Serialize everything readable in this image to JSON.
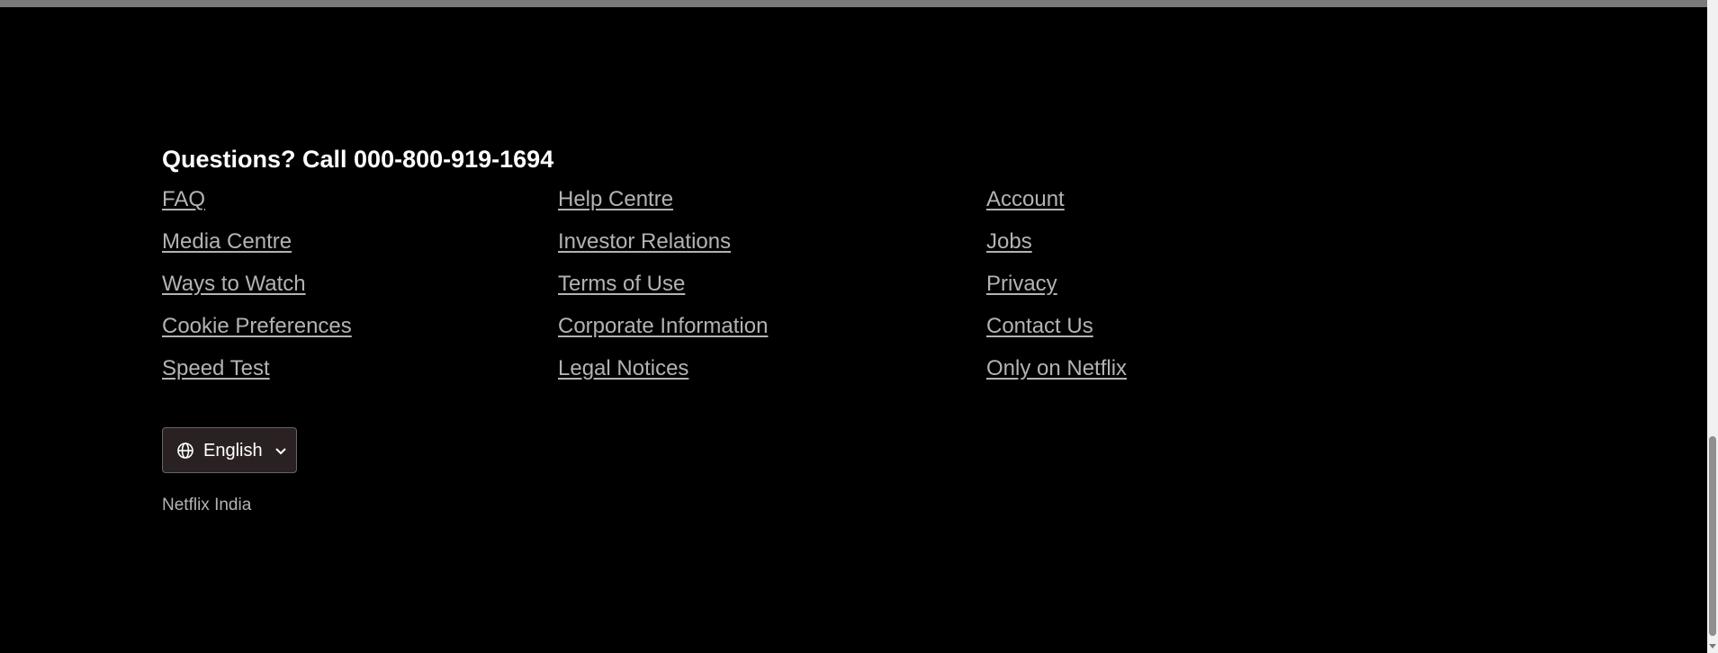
{
  "footer": {
    "heading": "Questions? Call 000-800-919-1694",
    "links": [
      {
        "label": "FAQ"
      },
      {
        "label": "Help Centre"
      },
      {
        "label": "Account"
      },
      {
        "label": "Media Centre"
      },
      {
        "label": "Investor Relations"
      },
      {
        "label": "Jobs"
      },
      {
        "label": "Ways to Watch"
      },
      {
        "label": "Terms of Use"
      },
      {
        "label": "Privacy"
      },
      {
        "label": "Cookie Preferences"
      },
      {
        "label": "Corporate Information"
      },
      {
        "label": "Contact Us"
      },
      {
        "label": "Speed Test"
      },
      {
        "label": "Legal Notices"
      },
      {
        "label": "Only on Netflix"
      }
    ],
    "language_selector": {
      "label": "English",
      "icon": "globe-icon",
      "dropdown_icon": "chevron-down-icon"
    },
    "region": "Netflix India"
  },
  "colors": {
    "background": "#000000",
    "heading": "#ffffff",
    "link": "#b3b3b3",
    "button_background": "#2a2222",
    "button_border": "#646464"
  }
}
